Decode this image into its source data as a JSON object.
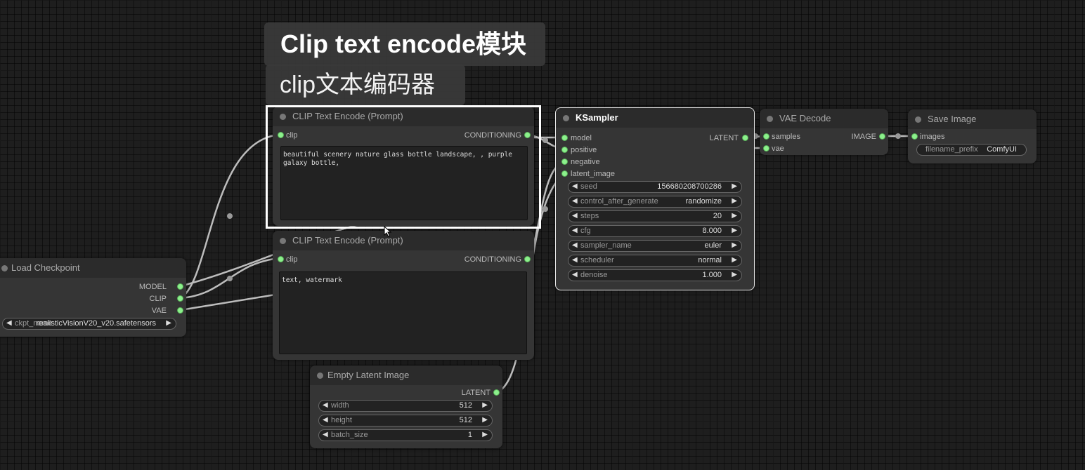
{
  "overlay": {
    "caption_title": "Clip text encode模块",
    "caption_subtitle": "clip文本编码器"
  },
  "nodes": {
    "clip_positive": {
      "title": "CLIP Text Encode (Prompt)",
      "input_clip": "clip",
      "output": "CONDITIONING",
      "text": "beautiful scenery nature glass bottle landscape, , purple galaxy bottle,"
    },
    "clip_negative": {
      "title": "CLIP Text Encode (Prompt)",
      "input_clip": "clip",
      "output": "CONDITIONING",
      "text": "text, watermark"
    },
    "load_checkpoint": {
      "title": "Load Checkpoint",
      "out_model": "MODEL",
      "out_clip": "CLIP",
      "out_vae": "VAE",
      "ckpt_label": "ckpt_name",
      "ckpt_value": "realisticVisionV20_v20.safetensors"
    },
    "ksampler": {
      "title": "KSampler",
      "in_model": "model",
      "in_positive": "positive",
      "in_negative": "negative",
      "in_latent": "latent_image",
      "output": "LATENT",
      "widgets": [
        {
          "label": "seed",
          "value": "156680208700286"
        },
        {
          "label": "control_after_generate",
          "value": "randomize"
        },
        {
          "label": "steps",
          "value": "20"
        },
        {
          "label": "cfg",
          "value": "8.000"
        },
        {
          "label": "sampler_name",
          "value": "euler"
        },
        {
          "label": "scheduler",
          "value": "normal"
        },
        {
          "label": "denoise",
          "value": "1.000"
        }
      ]
    },
    "vae_decode": {
      "title": "VAE Decode",
      "in_samples": "samples",
      "in_vae": "vae",
      "output": "IMAGE"
    },
    "save_image": {
      "title": "Save Image",
      "in_images": "images",
      "prefix_label": "filename_prefix",
      "prefix_value": "ComfyUI"
    },
    "empty_latent": {
      "title": "Empty Latent Image",
      "output": "LATENT",
      "widgets": [
        {
          "label": "width",
          "value": "512"
        },
        {
          "label": "height",
          "value": "512"
        },
        {
          "label": "batch_size",
          "value": "1"
        }
      ]
    }
  },
  "colors": {
    "background": "#1e1e1e",
    "node_body": "#353535",
    "node_title": "#2b2b2b",
    "pin": "#8cf08c",
    "wire": "#d8d8d8"
  }
}
